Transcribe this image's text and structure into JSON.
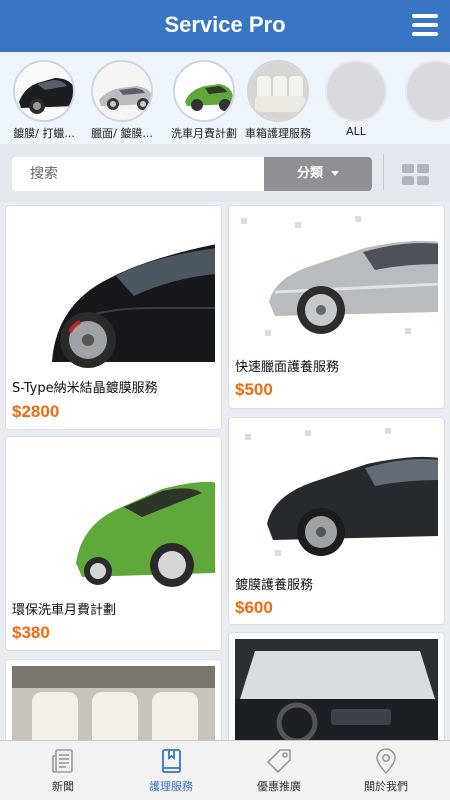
{
  "app": {
    "title": "Service Pro"
  },
  "categories": [
    {
      "label": "鍍膜/ 打蠟..."
    },
    {
      "label": "臘面/ 鍍膜..."
    },
    {
      "label": "洗車月費計劃"
    },
    {
      "label": "車箱護理服務"
    },
    {
      "label": "ALL"
    },
    {
      "label": ""
    }
  ],
  "search": {
    "placeholder": "搜索",
    "category_label": "分類"
  },
  "products": [
    {
      "name": "S-Type納米結晶鍍膜服務",
      "price": "$2800"
    },
    {
      "name": "快速臘面護養服務",
      "price": "$500"
    },
    {
      "name": "環保洗車月費計劃",
      "price": "$380"
    },
    {
      "name": "鍍膜護養服務",
      "price": "$600"
    },
    {
      "name": "",
      "price": ""
    },
    {
      "name": "",
      "price": ""
    }
  ],
  "tabs": [
    {
      "label": "新聞",
      "icon": "newspaper-icon"
    },
    {
      "label": "護理服務",
      "icon": "book-icon"
    },
    {
      "label": "優惠推廣",
      "icon": "tag-icon"
    },
    {
      "label": "關於我們",
      "icon": "location-pin-icon"
    }
  ],
  "colors": {
    "header": "#3876c4",
    "price": "#f06b13",
    "active_tab": "#3876c4",
    "inactive_tab": "#9a9a9a"
  }
}
